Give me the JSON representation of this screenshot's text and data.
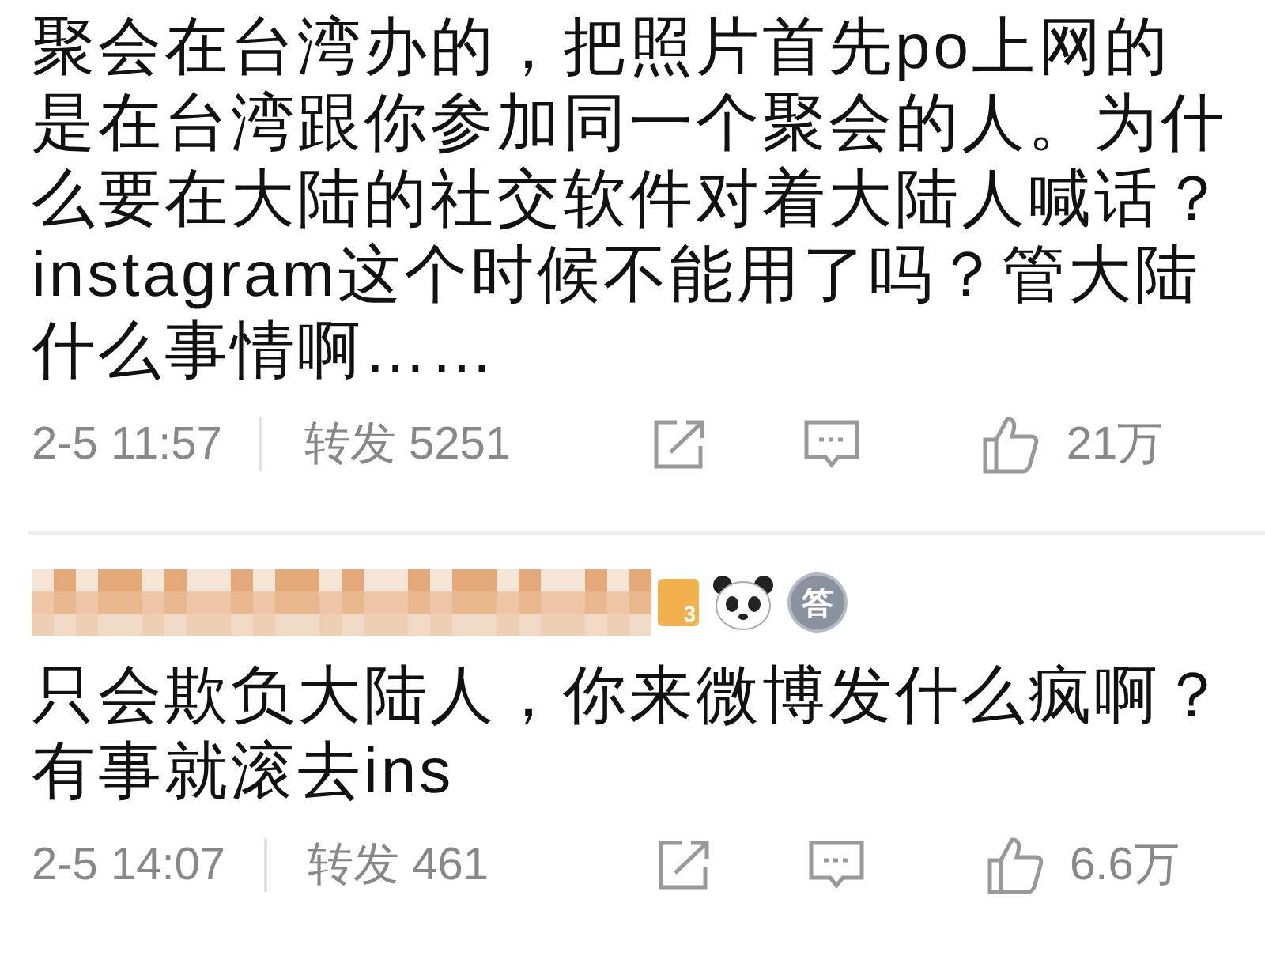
{
  "comments": [
    {
      "text": "聚会在台湾办的，把照片首先po上网的是在台湾跟你参加同一个聚会的人。为什么要在大陆的社交软件对着大陆人喊话？instagram这个时候不能用了吗？管大陆什么事情啊……",
      "time": "2-5 11:57",
      "repost": "转发 5251",
      "likes": "21万"
    },
    {
      "author": {
        "rank": "3",
        "medal": "答"
      },
      "text": "只会欺负大陆人，你来微博发什么疯啊？有事就滚去ins",
      "time": "2-5 14:07",
      "repost": "转发 461",
      "likes": "6.6万"
    }
  ]
}
